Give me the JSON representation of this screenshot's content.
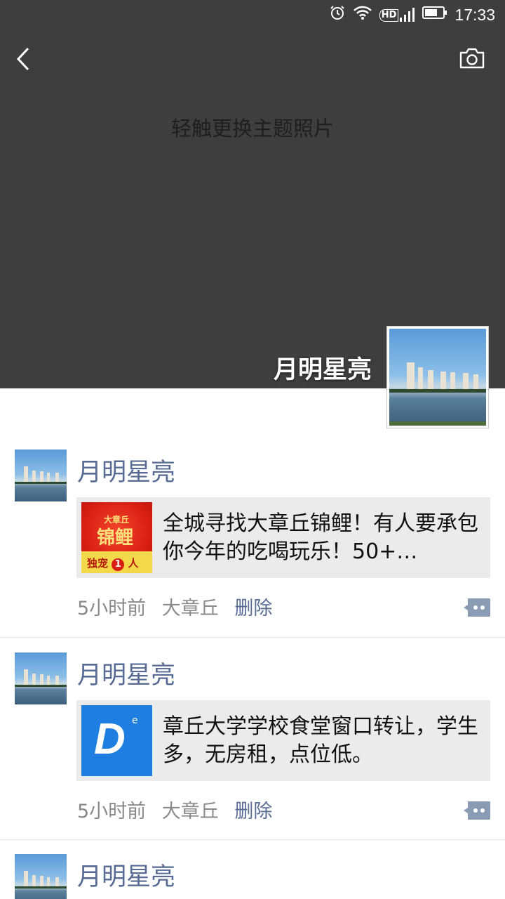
{
  "status_bar": {
    "time": "17:33",
    "hd_label": "HD",
    "icons": [
      "alarm-icon",
      "wifi-icon",
      "hd-signal-icon",
      "battery-icon"
    ]
  },
  "header": {
    "back_icon": "back-arrow-icon",
    "camera_icon": "camera-icon"
  },
  "cover": {
    "hint": "轻触更换主题照片"
  },
  "profile": {
    "name": "月明星亮"
  },
  "thumb1": {
    "top_text": "大章丘",
    "main_text": "锦鲤",
    "bottom_text": "独宠",
    "bottom_num": "1",
    "bottom_unit": "人"
  },
  "thumb2": {
    "letter": "D",
    "sup": "e"
  },
  "posts": [
    {
      "author": "月明星亮",
      "share_text": "全城寻找大章丘锦鲤！有人要承包你今年的吃喝玩乐！50+…",
      "time": "5小时前",
      "location": "大章丘",
      "delete_label": "删除"
    },
    {
      "author": "月明星亮",
      "share_text": "章丘大学学校食堂窗口转让，学生多，无房租，点位低。",
      "time": "5小时前",
      "location": "大章丘",
      "delete_label": "删除"
    },
    {
      "author": "月明星亮"
    }
  ],
  "colors": {
    "link": "#576b95",
    "cover_bg": "#3d3d3d",
    "card_bg": "#ebebeb"
  }
}
